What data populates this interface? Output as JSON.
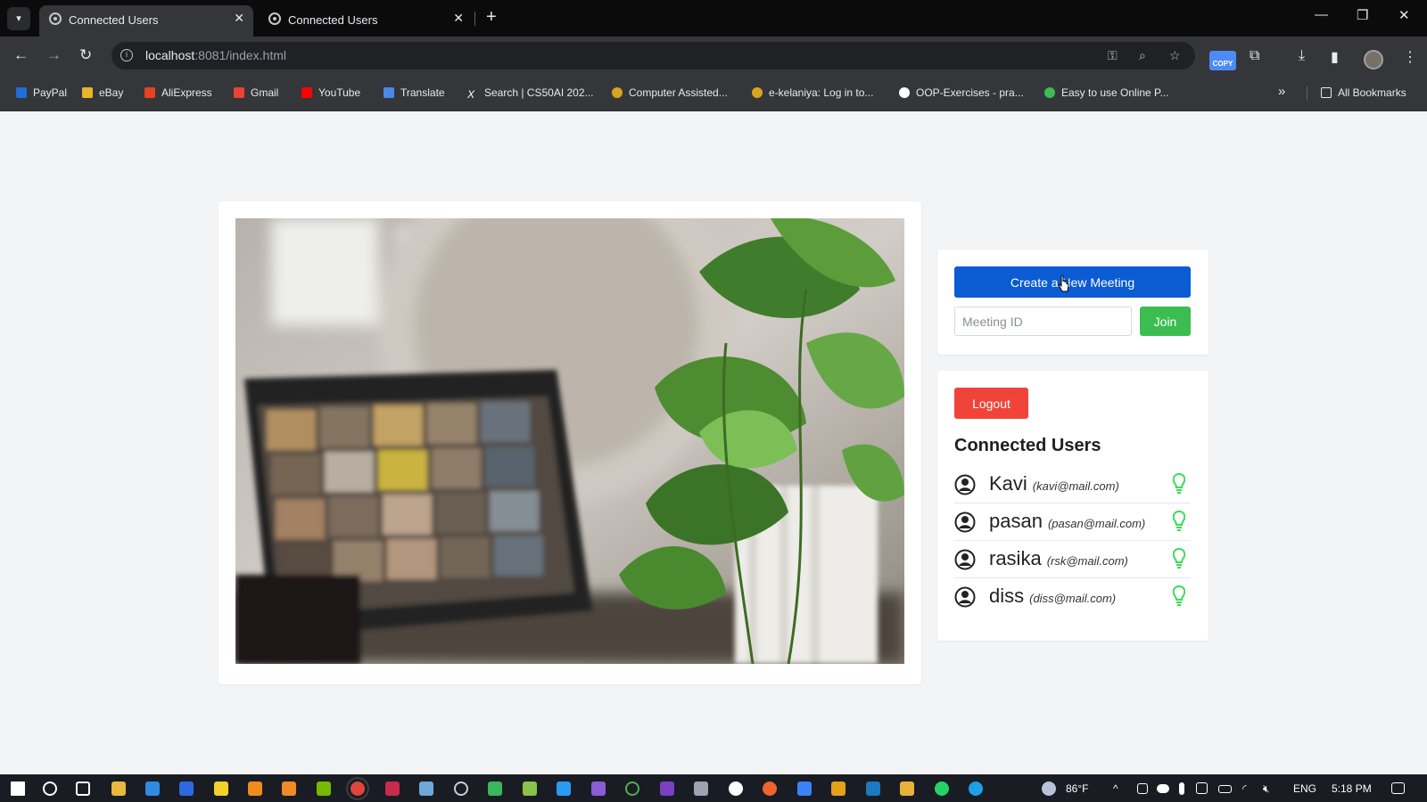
{
  "browser": {
    "tabs": [
      {
        "title": "Connected Users",
        "active": true
      },
      {
        "title": "Connected Users",
        "active": false
      }
    ],
    "url_host": "localhost",
    "url_path": ":8081/index.html",
    "bookmarks": [
      {
        "label": "PayPal",
        "color": "#1e6fd8"
      },
      {
        "label": "eBay",
        "color": "#e9b528"
      },
      {
        "label": "AliExpress",
        "color": "#e8421f"
      },
      {
        "label": "Gmail",
        "color": "#ea4335"
      },
      {
        "label": "YouTube",
        "color": "#ff0000"
      },
      {
        "label": "Translate",
        "color": "#4f86ec"
      },
      {
        "label": "Search | CS50AI 202...",
        "color": "#ffffff"
      },
      {
        "label": "Computer Assisted...",
        "color": "#d9a520"
      },
      {
        "label": "e-kelaniya: Log in to...",
        "color": "#d9a520"
      },
      {
        "label": "OOP-Exercises - pra...",
        "color": "#ffffff"
      },
      {
        "label": "Easy to use Online P...",
        "color": "#3cbd52"
      }
    ],
    "all_bookmarks": "All Bookmarks",
    "copy_ext": "COPY"
  },
  "meeting": {
    "create_label": "Create a New Meeting",
    "id_placeholder": "Meeting ID",
    "join_label": "Join"
  },
  "users_panel": {
    "logout_label": "Logout",
    "title": "Connected Users",
    "users": [
      {
        "name": "Kavi",
        "email": "(kavi@mail.com)",
        "status": "online"
      },
      {
        "name": "pasan",
        "email": "(pasan@mail.com)",
        "status": "online"
      },
      {
        "name": "rasika",
        "email": "(rsk@mail.com)",
        "status": "online"
      },
      {
        "name": "diss",
        "email": "(diss@mail.com)",
        "status": "online"
      }
    ]
  },
  "taskbar": {
    "weather": "86°F",
    "language": "ENG",
    "time": "5:18 PM"
  },
  "colors": {
    "create_button": "#0b5bd3",
    "join_button": "#3cbd52",
    "logout_button": "#f0443a",
    "online_indicator": "#3cdc56"
  }
}
